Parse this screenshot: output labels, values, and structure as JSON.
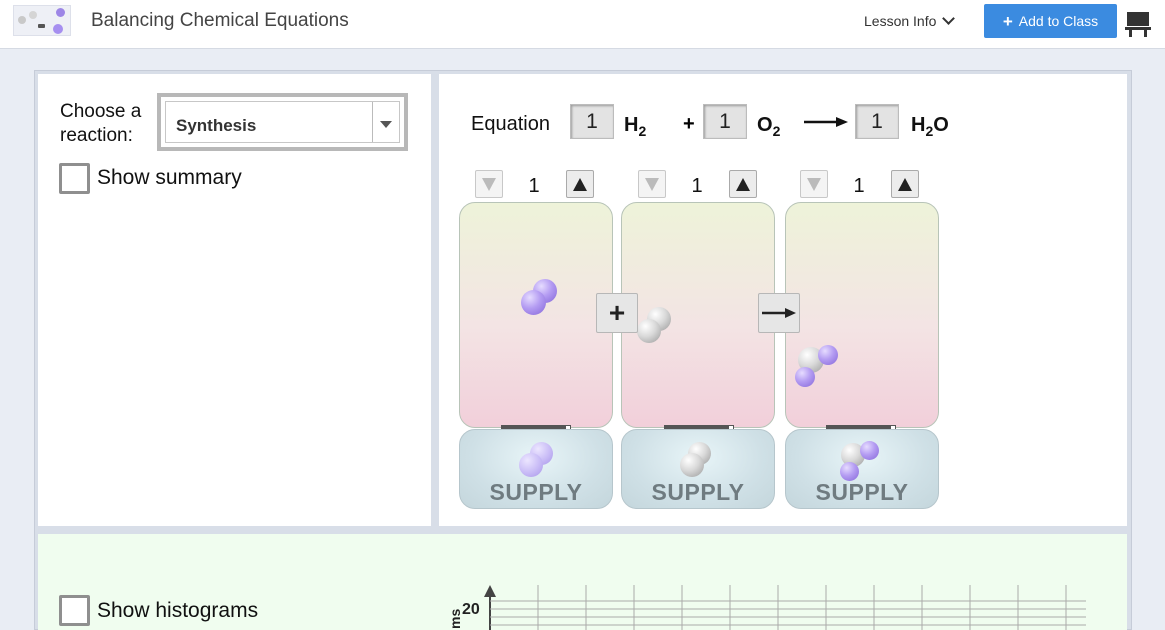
{
  "header": {
    "app_title": "Balancing Chemical Equations",
    "lesson_info": "Lesson Info",
    "add_to_class": "Add to Class"
  },
  "controls": {
    "choose_reaction_label": "Choose a reaction:",
    "reaction_selected": "Synthesis",
    "show_summary": "Show summary",
    "show_histograms": "Show histograms"
  },
  "equation": {
    "label": "Equation",
    "terms": [
      {
        "coefficient": "1",
        "formula": "H",
        "subscript": "2",
        "suffix": ""
      },
      {
        "coefficient": "1",
        "formula": "O",
        "subscript": "2",
        "suffix": ""
      },
      {
        "coefficient": "1",
        "formula": "H",
        "subscript": "2",
        "suffix": "O"
      }
    ],
    "plus": "+",
    "arrow": "arrow-right-icon"
  },
  "spinners": [
    "1",
    "1",
    "1"
  ],
  "supply": {
    "label": "SUPPLY"
  },
  "operators": {
    "plus": "+",
    "arrow": "arrow-right-icon"
  },
  "histogram": {
    "tick_20": "20",
    "axis_label": "ms"
  },
  "colors": {
    "accent": "#3b8be0",
    "hydrogen": "#a58cf0",
    "oxygen": "#cfcfcf",
    "bottom_panel": "#f0fdef"
  }
}
